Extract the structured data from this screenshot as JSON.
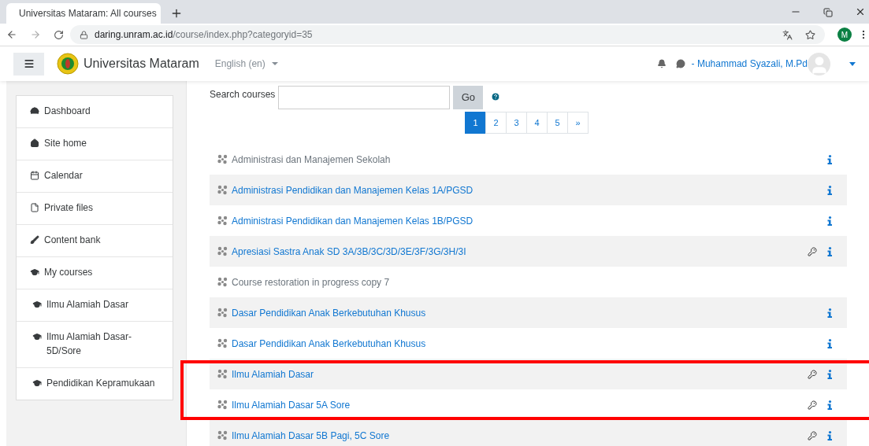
{
  "browser": {
    "tab_title": "Universitas Mataram: All courses",
    "url_domain": "daring.unram.ac.id",
    "url_path": "/course/index.php?categoryid=35",
    "profile_letter": "M"
  },
  "navbar": {
    "site_name": "Universitas Mataram",
    "language": "English (en)",
    "user_name": "- Muhammad Syazali, M.Pd"
  },
  "sidebar": {
    "items": [
      {
        "label": "Dashboard",
        "kind": "dashboard"
      },
      {
        "label": "Site home",
        "kind": "home"
      },
      {
        "label": "Calendar",
        "kind": "calendar"
      },
      {
        "label": "Private files",
        "kind": "files"
      },
      {
        "label": "Content bank",
        "kind": "brush"
      },
      {
        "label": "My courses",
        "kind": "courses"
      },
      {
        "label": "Ilmu Alamiah Dasar",
        "kind": "course"
      },
      {
        "label": "Ilmu Alamiah Dasar-5D/Sore",
        "kind": "course"
      },
      {
        "label": "Pendidikan Kepramukaan",
        "kind": "course"
      }
    ]
  },
  "search": {
    "label": "Search courses",
    "button": "Go"
  },
  "pagination": [
    {
      "label": "1",
      "selected": true
    },
    {
      "label": "2",
      "selected": false
    },
    {
      "label": "3",
      "selected": false
    },
    {
      "label": "4",
      "selected": false
    },
    {
      "label": "5",
      "selected": false
    },
    {
      "label": "»",
      "selected": false
    }
  ],
  "courses": [
    {
      "name": "Administrasi dan Manajemen Sekolah",
      "dimmed": true,
      "enrol_key": false,
      "info": true,
      "highlighted": false
    },
    {
      "name": "Administrasi Pendidikan dan Manajemen Kelas 1A/PGSD",
      "dimmed": false,
      "enrol_key": false,
      "info": true,
      "highlighted": false
    },
    {
      "name": "Administrasi Pendidikan dan Manajemen Kelas 1B/PGSD",
      "dimmed": false,
      "enrol_key": false,
      "info": true,
      "highlighted": false
    },
    {
      "name": "Apresiasi Sastra Anak SD 3A/3B/3C/3D/3E/3F/3G/3H/3I",
      "dimmed": false,
      "enrol_key": true,
      "info": true,
      "highlighted": false
    },
    {
      "name": "Course restoration in progress copy 7",
      "dimmed": true,
      "enrol_key": false,
      "info": false,
      "highlighted": false
    },
    {
      "name": "Dasar Pendidikan Anak Berkebutuhan Khusus",
      "dimmed": false,
      "enrol_key": false,
      "info": true,
      "highlighted": false
    },
    {
      "name": "Dasar Pendidikan Anak Berkebutuhan Khusus",
      "dimmed": false,
      "enrol_key": false,
      "info": true,
      "highlighted": false
    },
    {
      "name": "Ilmu Alamiah Dasar",
      "dimmed": false,
      "enrol_key": true,
      "info": true,
      "highlighted": true
    },
    {
      "name": "Ilmu Alamiah Dasar 5A Sore",
      "dimmed": false,
      "enrol_key": true,
      "info": true,
      "highlighted": true
    },
    {
      "name": "Ilmu Alamiah Dasar 5B Pagi, 5C Sore",
      "dimmed": false,
      "enrol_key": true,
      "info": true,
      "highlighted": false
    }
  ]
}
